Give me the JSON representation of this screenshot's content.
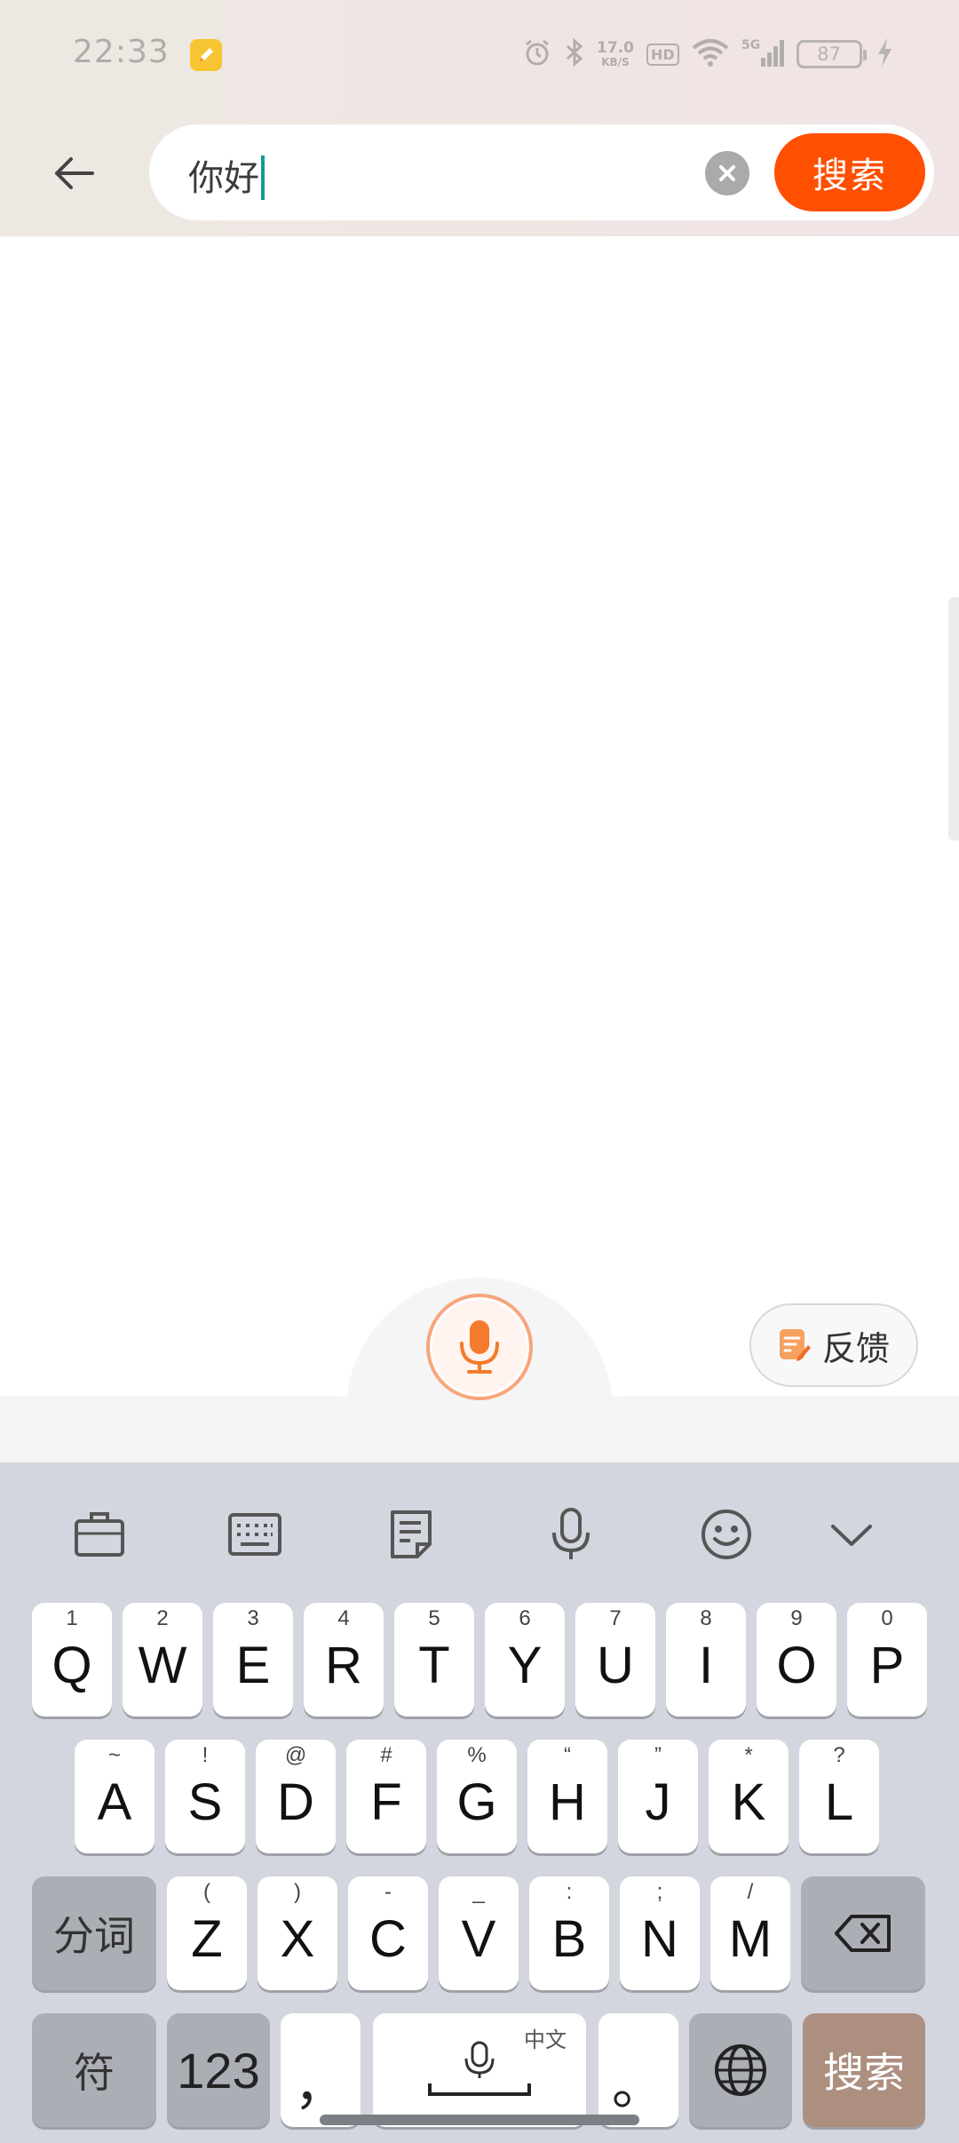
{
  "status_bar": {
    "time": "22:33",
    "net_speed_value": "17.0",
    "net_speed_unit": "KB/S",
    "hd_label": "HD",
    "battery": "87",
    "icons": [
      "note-app-icon",
      "alarm-icon",
      "bluetooth-icon",
      "wifi-icon",
      "signal-5g-icon",
      "charging-icon"
    ]
  },
  "search": {
    "query": "你好",
    "search_button_label": "搜索"
  },
  "voice": {
    "feedback_label": "反馈"
  },
  "keyboard": {
    "toolbar_icons": [
      "clipboard-icon",
      "keyboard-layout-icon",
      "notes-icon",
      "voice-input-icon",
      "emoji-icon",
      "collapse-keyboard-icon"
    ],
    "row1": [
      {
        "main": "Q",
        "sub": "1"
      },
      {
        "main": "W",
        "sub": "2"
      },
      {
        "main": "E",
        "sub": "3"
      },
      {
        "main": "R",
        "sub": "4"
      },
      {
        "main": "T",
        "sub": "5"
      },
      {
        "main": "Y",
        "sub": "6"
      },
      {
        "main": "U",
        "sub": "7"
      },
      {
        "main": "I",
        "sub": "8"
      },
      {
        "main": "O",
        "sub": "9"
      },
      {
        "main": "P",
        "sub": "0"
      }
    ],
    "row2": [
      {
        "main": "A",
        "sub": "~"
      },
      {
        "main": "S",
        "sub": "!"
      },
      {
        "main": "D",
        "sub": "@"
      },
      {
        "main": "F",
        "sub": "#"
      },
      {
        "main": "G",
        "sub": "%"
      },
      {
        "main": "H",
        "sub": "“"
      },
      {
        "main": "J",
        "sub": "”"
      },
      {
        "main": "K",
        "sub": "*"
      },
      {
        "main": "L",
        "sub": "?"
      }
    ],
    "row3": [
      {
        "main": "Z",
        "sub": "("
      },
      {
        "main": "X",
        "sub": ")"
      },
      {
        "main": "C",
        "sub": "-"
      },
      {
        "main": "V",
        "sub": "_"
      },
      {
        "main": "B",
        "sub": ":"
      },
      {
        "main": "N",
        "sub": ";"
      },
      {
        "main": "M",
        "sub": "/"
      }
    ],
    "segment_key": "分词",
    "symbols_key": "符",
    "numbers_key": "123",
    "comma_key": "，",
    "space_lang": "中文",
    "period_key": "。",
    "enter_key": "搜索"
  }
}
